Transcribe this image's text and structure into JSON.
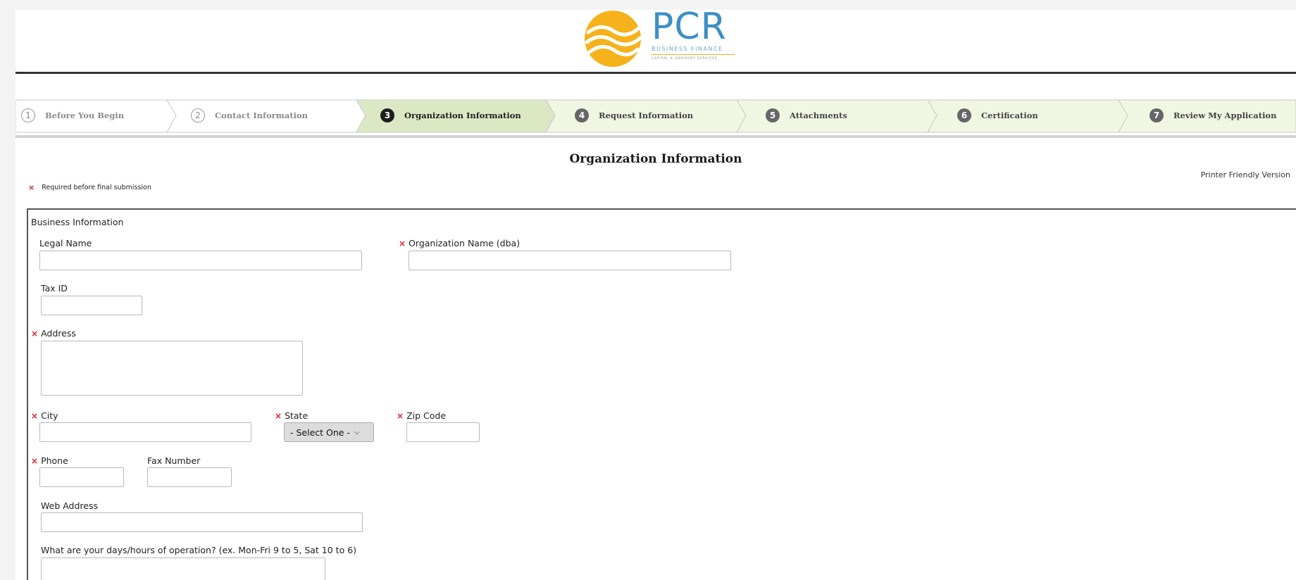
{
  "brand": {
    "name": "PCR",
    "tagline": "BUSINESS FINANCE",
    "subtagline": "CAPITAL & ADVISORY SERVICES",
    "colors": {
      "blue": "#3c8fc6",
      "orange": "#f6b21a"
    }
  },
  "wizard": {
    "steps": [
      {
        "num": "1",
        "label": "Before You Begin",
        "state": "done"
      },
      {
        "num": "2",
        "label": "Contact Information",
        "state": "done"
      },
      {
        "num": "3",
        "label": "Organization Information",
        "state": "current"
      },
      {
        "num": "4",
        "label": "Request Information",
        "state": "todo"
      },
      {
        "num": "5",
        "label": "Attachments",
        "state": "todo"
      },
      {
        "num": "6",
        "label": "Certification",
        "state": "todo"
      },
      {
        "num": "7",
        "label": "Review My Application",
        "state": "todo"
      }
    ],
    "colors": {
      "current_bg": "#dce8c4",
      "todo_bg": "#f1f6e3",
      "done_bg": "#ffffff"
    }
  },
  "page": {
    "title": "Organization Information",
    "printer_link": "Printer Friendly Version",
    "required_note": "Required before final submission",
    "required_marker": "×"
  },
  "form": {
    "legend": "Business Information",
    "legal_name": {
      "label": "Legal Name",
      "value": ""
    },
    "org_name": {
      "label": "Organization Name (dba)",
      "value": ""
    },
    "tax_id": {
      "label": "Tax ID",
      "value": ""
    },
    "address": {
      "label": "Address",
      "value": ""
    },
    "city": {
      "label": "City",
      "value": ""
    },
    "state": {
      "label": "State",
      "selected": "- Select One -"
    },
    "zip": {
      "label": "Zip Code",
      "value": ""
    },
    "phone": {
      "label": "Phone",
      "value": ""
    },
    "fax": {
      "label": "Fax Number",
      "value": ""
    },
    "web": {
      "label": "Web Address",
      "value": ""
    },
    "hours": {
      "label": "What are your days/hours of operation? (ex. Mon-Fri 9 to 5, Sat 10 to 6)",
      "value": ""
    }
  }
}
